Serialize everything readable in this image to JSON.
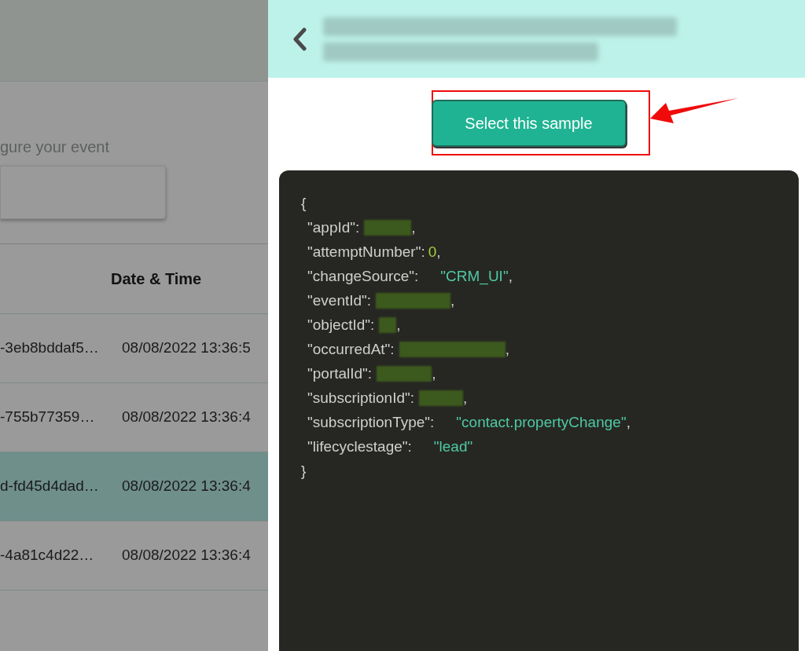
{
  "left_panel": {
    "instruction": "gure your event",
    "table": {
      "header": "Date & Time",
      "rows": [
        {
          "column_1": "-3eb8bddaf5…",
          "date_time": "08/08/2022 13:36:5",
          "selected": false
        },
        {
          "column_1": "-755b77359…",
          "date_time": "08/08/2022 13:36:4",
          "selected": false
        },
        {
          "column_1": "d-fd45d4dad…",
          "date_time": "08/08/2022 13:36:4",
          "selected": true
        },
        {
          "column_1": "-4a81c4d22…",
          "date_time": "08/08/2022 13:36:4",
          "selected": false
        }
      ]
    }
  },
  "sample_panel": {
    "button": "Select this sample",
    "code": {
      "open": "{",
      "close": "}",
      "lines": [
        {
          "key": "\"appId\":",
          "kind": "redacted",
          "trail": ","
        },
        {
          "key": "\"attemptNumber\":",
          "kind": "number",
          "value": "0",
          "trail": ","
        },
        {
          "key": "\"changeSource\":",
          "kind": "string",
          "value": "\"CRM_UI\"",
          "trail": ","
        },
        {
          "key": "\"eventId\":",
          "kind": "redacted",
          "trail": ","
        },
        {
          "key": "\"objectId\":",
          "kind": "redacted",
          "trail": ","
        },
        {
          "key": "\"occurredAt\":",
          "kind": "redacted",
          "trail": ","
        },
        {
          "key": "\"portalId\":",
          "kind": "redacted",
          "trail": ","
        },
        {
          "key": "\"subscriptionId\":",
          "kind": "redacted",
          "trail": ","
        },
        {
          "key": "\"subscriptionType\":",
          "kind": "string",
          "value": "\"contact.propertyChange\"",
          "trail": ","
        },
        {
          "key": "\"lifecyclestage\":",
          "kind": "string",
          "value": "\"lead\""
        }
      ]
    }
  }
}
